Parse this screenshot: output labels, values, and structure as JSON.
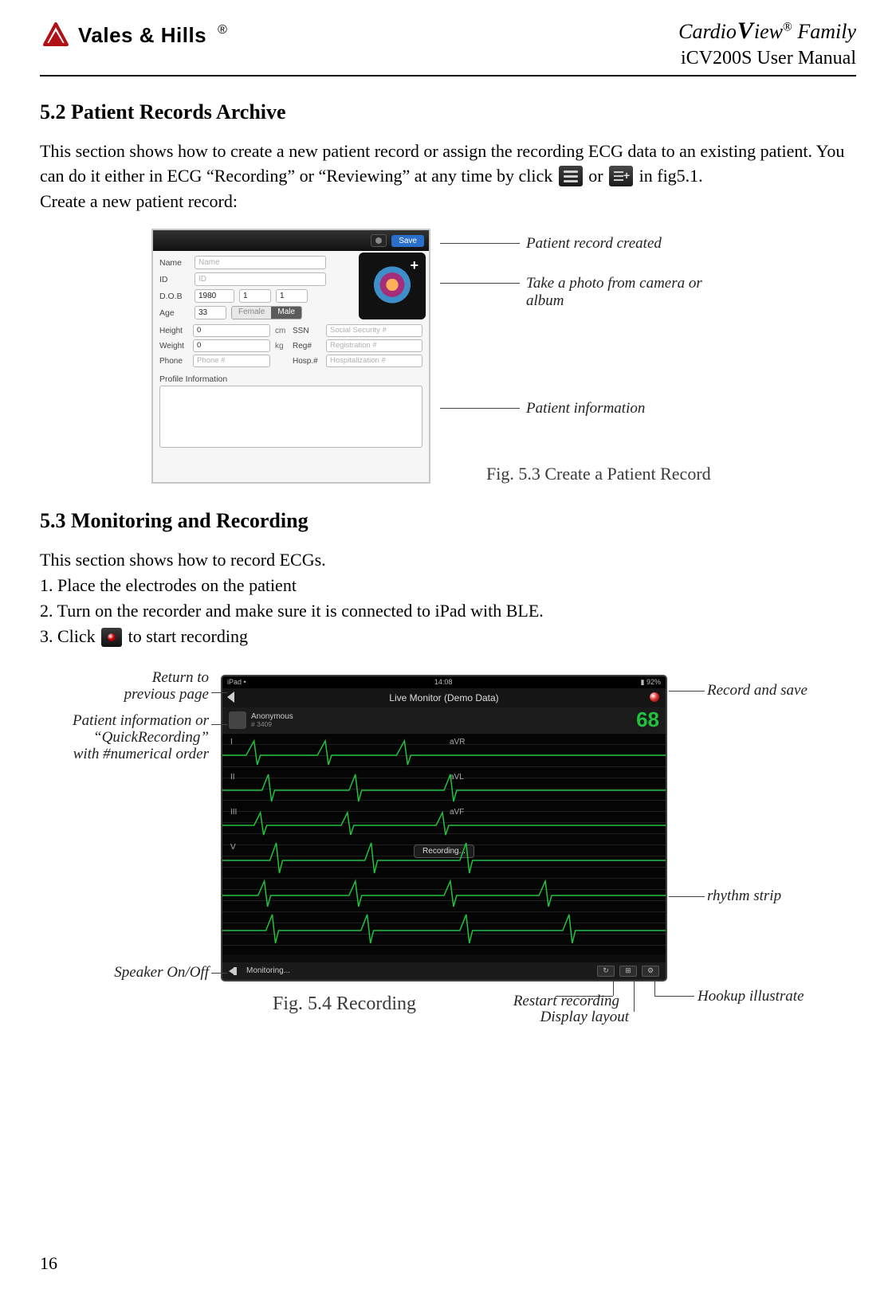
{
  "header": {
    "brand": "Vales & Hills",
    "reg": "®",
    "product_cardio": "Cardio",
    "product_v": "V",
    "product_iew": "iew",
    "product_sup": "®",
    "product_family": " Family",
    "manual_sub": "iCV200S User Manual"
  },
  "section52": {
    "heading": "5.2 Patient Records Archive",
    "p1a": "This section shows how to create a new patient record or assign the recording ECG data to an existing patient. You can do it either in ECG “Recording” or “Reviewing” at any time by click ",
    "p1b": " or ",
    "p1c": "in fig5.1.",
    "p2": "Create a new patient record:"
  },
  "fig53": {
    "save": "Save",
    "labels": {
      "name": "Name",
      "id": "ID",
      "dob": "D.O.B",
      "age": "Age",
      "height": "Height",
      "weight": "Weight",
      "phone": "Phone",
      "ssn": "SSN",
      "reg": "Reg#",
      "hosp": "Hosp.#",
      "profile": "Profile Information"
    },
    "placeholders": {
      "name": "Name",
      "id": "ID",
      "phone": "Phone #",
      "ssn": "Social Security #",
      "reg": "Registration #",
      "hosp": "Hospitalization #"
    },
    "values": {
      "dob_y": "1980",
      "dob_m": "1",
      "dob_d": "1",
      "age": "33",
      "height": "0",
      "weight": "0"
    },
    "units": {
      "cm": "cm",
      "kg": "kg"
    },
    "gender": {
      "female": "Female",
      "male": "Male"
    },
    "annotations": {
      "created": "Patient record created",
      "photo": "Take a photo from camera or album",
      "info": "Patient information"
    },
    "caption": "Fig. 5.3 Create a Patient Record"
  },
  "section53": {
    "heading": "5.3 Monitoring and Recording",
    "p1": "This section shows how to record ECGs.",
    "l1": "1. Place the electrodes on the patient",
    "l2": "2. Turn on the recorder and make sure it is connected to iPad with BLE.",
    "l3a": "3. Click ",
    "l3b": " to start recording"
  },
  "fig54": {
    "status": {
      "left": "iPad •",
      "center": "14:08",
      "right": "▮ 92%"
    },
    "title": "Live Monitor (Demo Data)",
    "anon": "Anonymous",
    "anon_id": "# 3409",
    "hr": "68",
    "leads": [
      "I",
      "aVR",
      "II",
      "aVL",
      "III",
      "aVF",
      "V"
    ],
    "recording": "Recording...",
    "monitoring": "Monitoring...",
    "tools": [
      "↻",
      "⊞",
      "⚙"
    ],
    "annotations": {
      "return": "Return to previous page",
      "patient": "Patient information or “QuickRecording” with #numerical order",
      "speaker": "Speaker On/Off",
      "record": "Record and save",
      "rhythm": "rhythm strip",
      "restart": "Restart recording",
      "layout": "Display layout",
      "hookup": "Hookup illustrate"
    },
    "caption": "Fig. 5.4  Recording"
  },
  "page_number": "16"
}
